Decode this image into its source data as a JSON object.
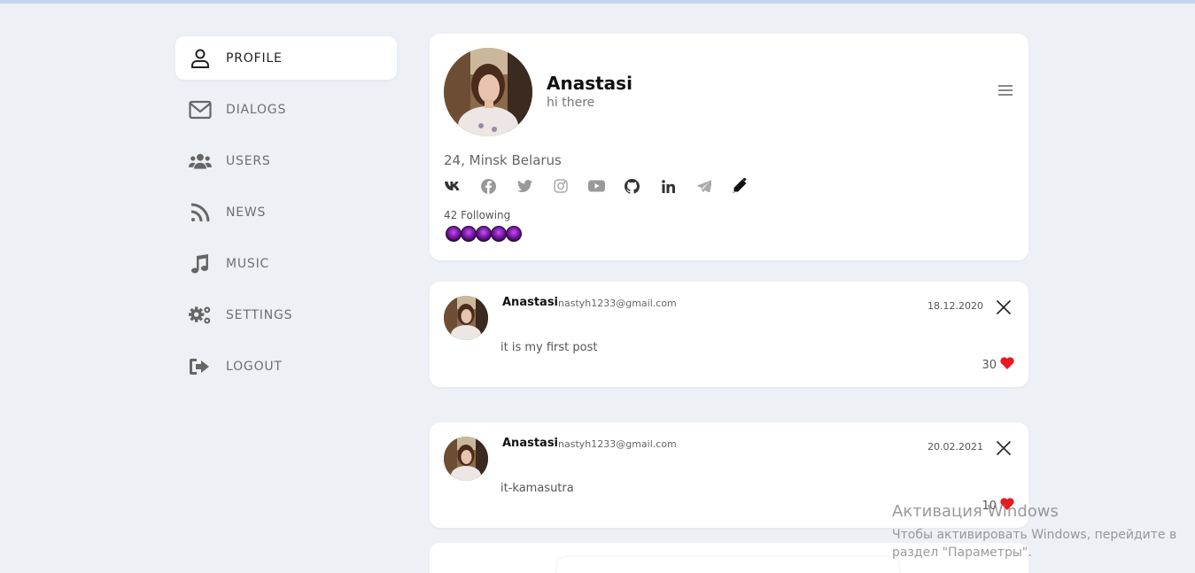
{
  "nav": {
    "items": [
      {
        "label": "PROFILE",
        "icon": "user-icon",
        "active": true
      },
      {
        "label": "DIALOGS",
        "icon": "envelope-icon",
        "active": false
      },
      {
        "label": "USERS",
        "icon": "users-icon",
        "active": false
      },
      {
        "label": "NEWS",
        "icon": "rss-icon",
        "active": false
      },
      {
        "label": "MUSIC",
        "icon": "music-icon",
        "active": false
      },
      {
        "label": "SETTINGS",
        "icon": "gears-icon",
        "active": false
      },
      {
        "label": "LOGOUT",
        "icon": "logout-icon",
        "active": false
      }
    ]
  },
  "profile": {
    "name": "Anastasi",
    "status": "hi there",
    "info": "24, Minsk Belarus",
    "socials": [
      "vk-icon",
      "facebook-icon",
      "twitter-icon",
      "instagram-icon",
      "youtube-icon",
      "github-icon",
      "linkedin-icon",
      "telegram-icon",
      "edit-pencil-icon"
    ],
    "following": "42 Following",
    "friends_count": 5
  },
  "posts": [
    {
      "author": "Anastasi",
      "email": "nastyh1233@gmail.com",
      "date": "18.12.2020",
      "text": "it is my first post",
      "likes": "30"
    },
    {
      "author": "Anastasi",
      "email": "nastyh1233@gmail.com",
      "date": "20.02.2021",
      "text": "it-kamasutra",
      "likes": "10"
    }
  ],
  "watermark": {
    "title": "Активация Windows",
    "line1": "Чтобы активировать Windows, перейдите в",
    "line2": "раздел \"Параметры\"."
  },
  "colors": {
    "background": "#edf1f6",
    "heart": "#e8191f",
    "friend_avatar": "#8a1fbf"
  }
}
